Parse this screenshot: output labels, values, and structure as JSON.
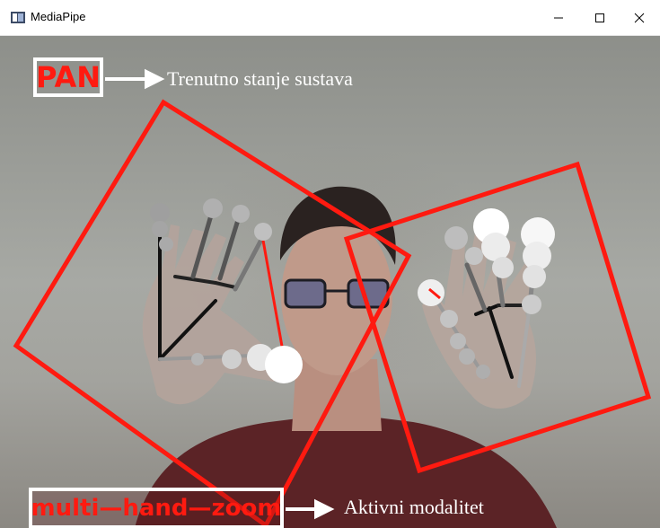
{
  "window": {
    "title": "MediaPipe",
    "app_icon": "window-app-icon",
    "controls": [
      "minimize-icon",
      "maximize-icon",
      "close-icon"
    ]
  },
  "overlay": {
    "state_label": "PAN",
    "state_caption": "Trenutno stanje sustava",
    "modality_label": "multi—hand—zoom",
    "modality_caption": "Aktivni modalitet",
    "text_color": "#ff1a10",
    "box_color": "#ffffff",
    "bounding_box_color": "#ff1a10"
  }
}
